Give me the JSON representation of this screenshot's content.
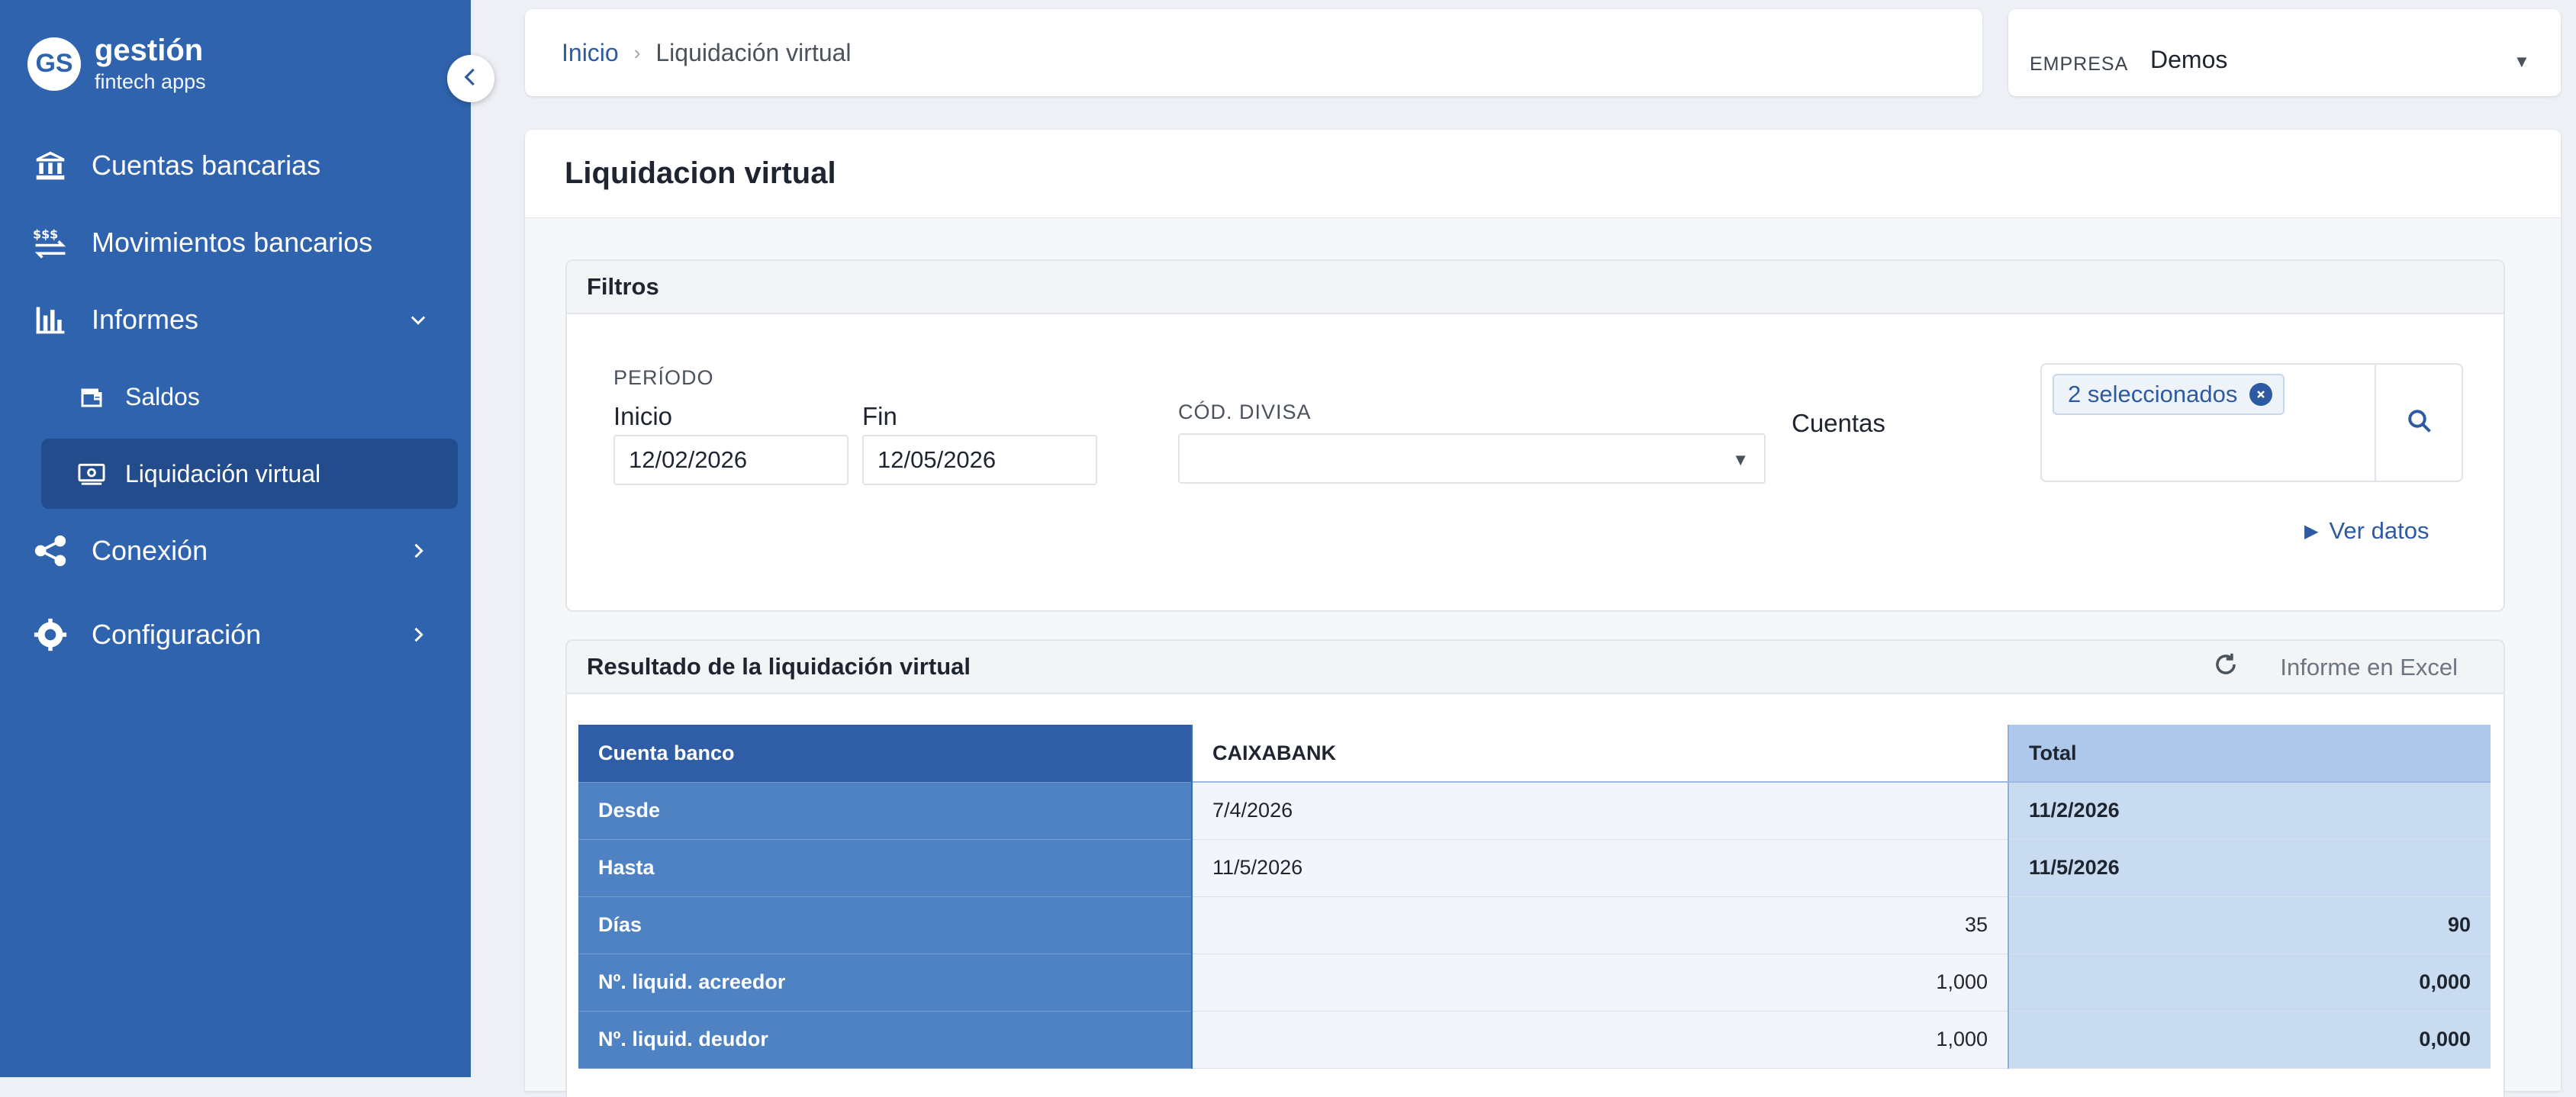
{
  "sidebar": {
    "brand": {
      "logo": "GS",
      "title": "gestión",
      "subtitle": "fintech apps"
    },
    "items": [
      {
        "label": "Cuentas bancarias",
        "icon": "bank-icon"
      },
      {
        "label": "Movimientos bancarios",
        "icon": "money-transfer-icon"
      },
      {
        "label": "Informes",
        "icon": "bar-chart-icon",
        "expanded": true,
        "children": [
          {
            "label": "Saldos",
            "icon": "wallet-icon"
          },
          {
            "label": "Liquidación virtual",
            "icon": "banknote-icon",
            "active": true
          }
        ]
      },
      {
        "label": "Conexión",
        "icon": "share-nodes-icon"
      },
      {
        "label": "Configuración",
        "icon": "gear-icon"
      }
    ]
  },
  "header": {
    "breadcrumb": {
      "home": "Inicio",
      "current": "Liquidación virtual"
    },
    "company": {
      "label": "EMPRESA",
      "value": "Demos"
    }
  },
  "page": {
    "title": "Liquidacion virtual"
  },
  "filters": {
    "title": "Filtros",
    "period_label": "PERÍODO",
    "start_label": "Inicio",
    "start_value": "12/02/2026",
    "end_label": "Fin",
    "end_value": "12/05/2026",
    "currency_label": "CÓD. DIVISA",
    "currency_value": "",
    "accounts_label": "Cuentas",
    "accounts_chip": "2 seleccionados",
    "view_data_label": "Ver datos"
  },
  "results": {
    "title": "Resultado de la liquidación virtual",
    "excel_label": "Informe en Excel",
    "table": {
      "header": {
        "label": "Cuenta banco",
        "bank": "CAIXABANK",
        "total": "Total"
      },
      "rows": [
        {
          "label": "Desde",
          "bank": "7/4/2026",
          "total": "11/2/2026"
        },
        {
          "label": "Hasta",
          "bank": "11/5/2026",
          "total": "11/5/2026"
        },
        {
          "label": "Días",
          "bank": "35",
          "total": "90"
        },
        {
          "label": "Nº. liquid. acreedor",
          "bank": "1,000",
          "total": "0,000"
        },
        {
          "label": "Nº. liquid. deudor",
          "bank": "1,000",
          "total": "0,000"
        }
      ]
    }
  },
  "colors": {
    "sidebar": "#3063ad",
    "sidebar_active": "#234c8c",
    "accent": "#2d5aa0",
    "table_header": "#2f5ea6",
    "table_label": "#4e82c2",
    "table_total": "#c9dbf1"
  }
}
